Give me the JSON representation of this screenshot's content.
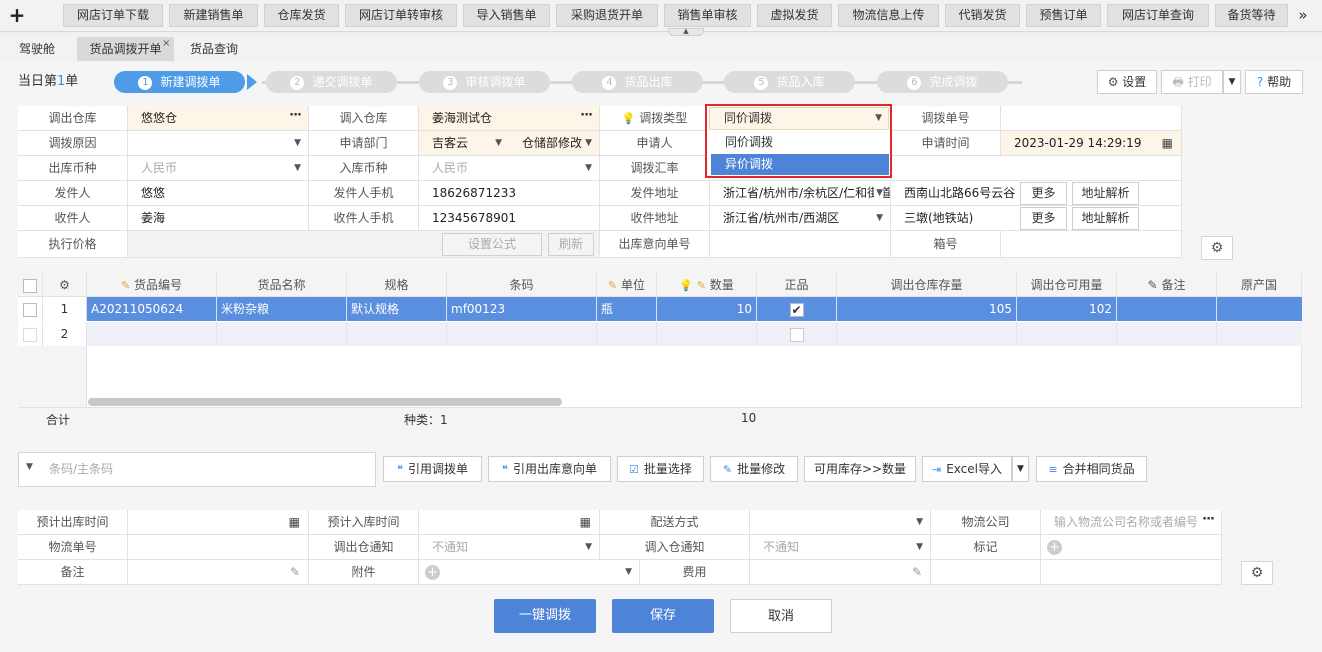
{
  "toolbar": {
    "plus_label": "+",
    "buttons": [
      "网店订单下载",
      "新建销售单",
      "仓库发货",
      "网店订单转审核",
      "导入销售单",
      "采购退货开单",
      "销售单审核",
      "虚拟发货",
      "物流信息上传",
      "代销发货",
      "预售订单",
      "网店订单查询",
      "备货等待"
    ],
    "more": "»",
    "handle": "▲"
  },
  "tabs": {
    "items": [
      "驾驶舱",
      "货品调拨开单",
      "货品查询"
    ],
    "close": "×"
  },
  "header": {
    "day_prefix": "当日第",
    "day_num": "1",
    "day_suffix": "单",
    "steps": [
      {
        "num": "1",
        "label": "新建调拨单"
      },
      {
        "num": "2",
        "label": "递交调拨单"
      },
      {
        "num": "3",
        "label": "审核调拨单"
      },
      {
        "num": "4",
        "label": "货品出库"
      },
      {
        "num": "5",
        "label": "货品入库"
      },
      {
        "num": "6",
        "label": "完成调拨"
      }
    ],
    "settings_label": "设置",
    "print_label": "打印",
    "help_label": "帮助"
  },
  "form": {
    "out_wh_label": "调出仓库",
    "out_wh": "悠悠仓",
    "in_wh_label": "调入仓库",
    "in_wh": "姜海测试仓",
    "type_label": "调拨类型",
    "order_no_label": "调拨单号",
    "reason_label": "调拨原因",
    "dept_label": "申请部门",
    "dept": "吉客云",
    "dept2": "仓储部修改",
    "applicant_label": "申请人",
    "apply_time_label": "申请时间",
    "apply_time": "2023-01-29 14:29:19",
    "out_currency_label": "出库币种",
    "out_currency": "人民币",
    "in_currency_label": "入库币种",
    "in_currency": "人民币",
    "rate_label": "调拨汇率",
    "sender_label": "发件人",
    "sender": "悠悠",
    "sender_phone_label": "发件人手机",
    "sender_phone": "18626871233",
    "sender_addr_label": "发件地址",
    "sender_addr": "浙江省/杭州市/余杭区/仁和街道",
    "sender_addr_detail": "西南山北路66号云谷",
    "receiver_label": "收件人",
    "receiver": "姜海",
    "receiver_phone_label": "收件人手机",
    "receiver_phone": "12345678901",
    "receiver_addr_label": "收件地址",
    "receiver_addr": "浙江省/杭州市/西湖区",
    "receiver_addr_detail": "三墩(地铁站)",
    "more_label": "更多",
    "parse_label": "地址解析",
    "exec_price_label": "执行价格",
    "set_formula_label": "设置公式",
    "refresh_label": "刷新",
    "out_intent_label": "出库意向单号",
    "box_label": "箱号"
  },
  "dropdown": {
    "selected": "同价调拨",
    "options": [
      "同价调拨",
      "异价调拨"
    ]
  },
  "grid": {
    "headers": [
      "货品编号",
      "货品名称",
      "规格",
      "条码",
      "单位",
      "数量",
      "正品",
      "调出仓库存量",
      "调出仓可用量",
      "备注",
      "原产国"
    ],
    "rows": [
      {
        "idx": "1",
        "code": "A20211050624",
        "name": "米粉杂粮",
        "spec": "默认规格",
        "barcode": "mf00123",
        "unit": "瓶",
        "qty": "10",
        "stock": "105",
        "avail": "102"
      },
      {
        "idx": "2"
      }
    ],
    "total_label": "合计",
    "kinds": "种类：1",
    "total_qty": "10"
  },
  "actions": {
    "scan_placeholder": "条码/主条码",
    "buttons": [
      "引用调拨单",
      "引用出库意向单",
      "批量选择",
      "批量修改",
      "可用库存>>数量",
      "Excel导入",
      "合并相同货品"
    ]
  },
  "bottom_form": {
    "expect_out_label": "预计出库时间",
    "expect_in_label": "预计入库时间",
    "delivery_label": "配送方式",
    "logistics_co_label": "物流公司",
    "logistics_co_ph": "输入物流公司名称或者编号",
    "logistics_no_label": "物流单号",
    "out_notify_label": "调出仓通知",
    "out_notify": "不通知",
    "in_notify_label": "调入仓通知",
    "in_notify": "不通知",
    "mark_label": "标记",
    "remark_label": "备注",
    "attach_label": "附件",
    "fee_label": "费用"
  },
  "footer": {
    "quick_label": "一键调拨",
    "save_label": "保存",
    "cancel_label": "取消"
  }
}
